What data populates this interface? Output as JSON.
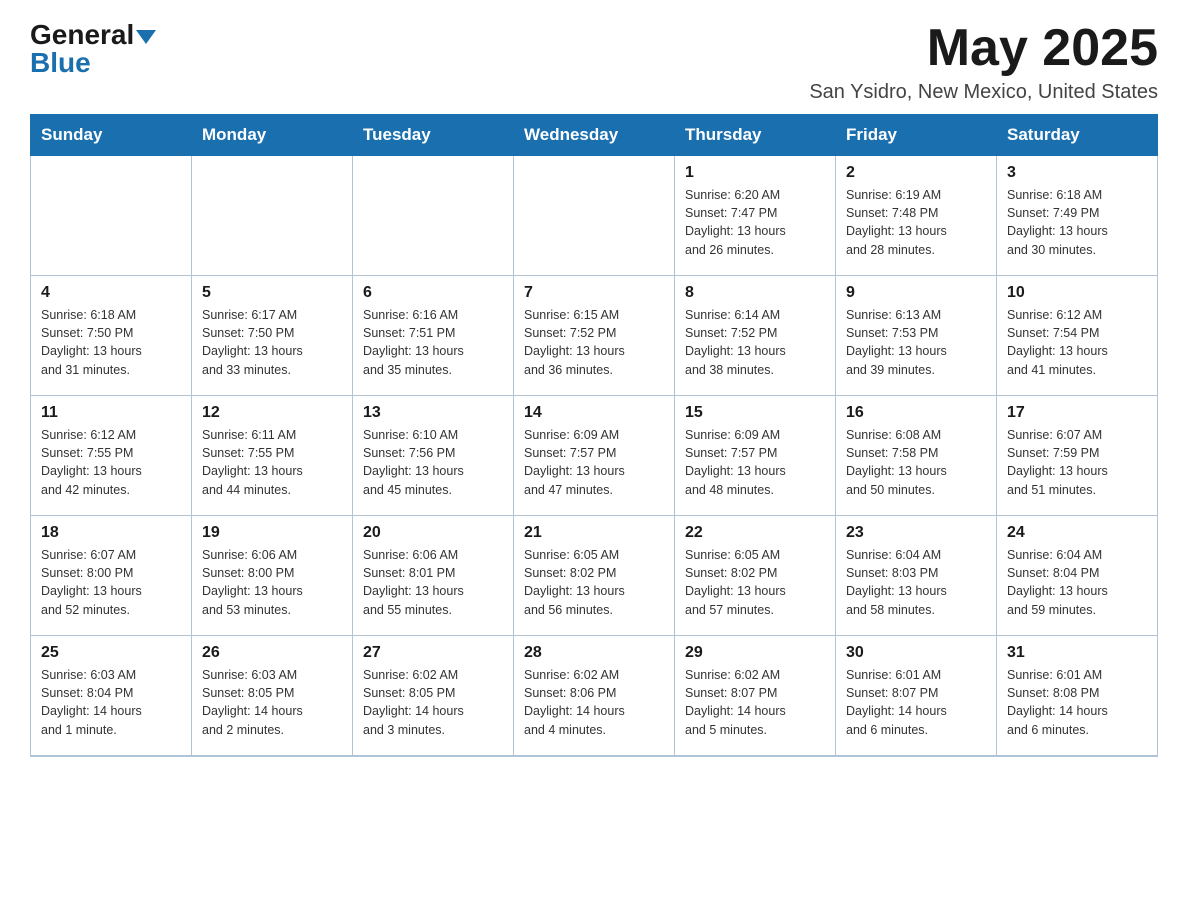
{
  "header": {
    "logo_line1": "General",
    "logo_line2": "Blue",
    "month_year": "May 2025",
    "location": "San Ysidro, New Mexico, United States"
  },
  "days_of_week": [
    "Sunday",
    "Monday",
    "Tuesday",
    "Wednesday",
    "Thursday",
    "Friday",
    "Saturday"
  ],
  "weeks": [
    [
      {
        "day": "",
        "info": ""
      },
      {
        "day": "",
        "info": ""
      },
      {
        "day": "",
        "info": ""
      },
      {
        "day": "",
        "info": ""
      },
      {
        "day": "1",
        "info": "Sunrise: 6:20 AM\nSunset: 7:47 PM\nDaylight: 13 hours\nand 26 minutes."
      },
      {
        "day": "2",
        "info": "Sunrise: 6:19 AM\nSunset: 7:48 PM\nDaylight: 13 hours\nand 28 minutes."
      },
      {
        "day": "3",
        "info": "Sunrise: 6:18 AM\nSunset: 7:49 PM\nDaylight: 13 hours\nand 30 minutes."
      }
    ],
    [
      {
        "day": "4",
        "info": "Sunrise: 6:18 AM\nSunset: 7:50 PM\nDaylight: 13 hours\nand 31 minutes."
      },
      {
        "day": "5",
        "info": "Sunrise: 6:17 AM\nSunset: 7:50 PM\nDaylight: 13 hours\nand 33 minutes."
      },
      {
        "day": "6",
        "info": "Sunrise: 6:16 AM\nSunset: 7:51 PM\nDaylight: 13 hours\nand 35 minutes."
      },
      {
        "day": "7",
        "info": "Sunrise: 6:15 AM\nSunset: 7:52 PM\nDaylight: 13 hours\nand 36 minutes."
      },
      {
        "day": "8",
        "info": "Sunrise: 6:14 AM\nSunset: 7:52 PM\nDaylight: 13 hours\nand 38 minutes."
      },
      {
        "day": "9",
        "info": "Sunrise: 6:13 AM\nSunset: 7:53 PM\nDaylight: 13 hours\nand 39 minutes."
      },
      {
        "day": "10",
        "info": "Sunrise: 6:12 AM\nSunset: 7:54 PM\nDaylight: 13 hours\nand 41 minutes."
      }
    ],
    [
      {
        "day": "11",
        "info": "Sunrise: 6:12 AM\nSunset: 7:55 PM\nDaylight: 13 hours\nand 42 minutes."
      },
      {
        "day": "12",
        "info": "Sunrise: 6:11 AM\nSunset: 7:55 PM\nDaylight: 13 hours\nand 44 minutes."
      },
      {
        "day": "13",
        "info": "Sunrise: 6:10 AM\nSunset: 7:56 PM\nDaylight: 13 hours\nand 45 minutes."
      },
      {
        "day": "14",
        "info": "Sunrise: 6:09 AM\nSunset: 7:57 PM\nDaylight: 13 hours\nand 47 minutes."
      },
      {
        "day": "15",
        "info": "Sunrise: 6:09 AM\nSunset: 7:57 PM\nDaylight: 13 hours\nand 48 minutes."
      },
      {
        "day": "16",
        "info": "Sunrise: 6:08 AM\nSunset: 7:58 PM\nDaylight: 13 hours\nand 50 minutes."
      },
      {
        "day": "17",
        "info": "Sunrise: 6:07 AM\nSunset: 7:59 PM\nDaylight: 13 hours\nand 51 minutes."
      }
    ],
    [
      {
        "day": "18",
        "info": "Sunrise: 6:07 AM\nSunset: 8:00 PM\nDaylight: 13 hours\nand 52 minutes."
      },
      {
        "day": "19",
        "info": "Sunrise: 6:06 AM\nSunset: 8:00 PM\nDaylight: 13 hours\nand 53 minutes."
      },
      {
        "day": "20",
        "info": "Sunrise: 6:06 AM\nSunset: 8:01 PM\nDaylight: 13 hours\nand 55 minutes."
      },
      {
        "day": "21",
        "info": "Sunrise: 6:05 AM\nSunset: 8:02 PM\nDaylight: 13 hours\nand 56 minutes."
      },
      {
        "day": "22",
        "info": "Sunrise: 6:05 AM\nSunset: 8:02 PM\nDaylight: 13 hours\nand 57 minutes."
      },
      {
        "day": "23",
        "info": "Sunrise: 6:04 AM\nSunset: 8:03 PM\nDaylight: 13 hours\nand 58 minutes."
      },
      {
        "day": "24",
        "info": "Sunrise: 6:04 AM\nSunset: 8:04 PM\nDaylight: 13 hours\nand 59 minutes."
      }
    ],
    [
      {
        "day": "25",
        "info": "Sunrise: 6:03 AM\nSunset: 8:04 PM\nDaylight: 14 hours\nand 1 minute."
      },
      {
        "day": "26",
        "info": "Sunrise: 6:03 AM\nSunset: 8:05 PM\nDaylight: 14 hours\nand 2 minutes."
      },
      {
        "day": "27",
        "info": "Sunrise: 6:02 AM\nSunset: 8:05 PM\nDaylight: 14 hours\nand 3 minutes."
      },
      {
        "day": "28",
        "info": "Sunrise: 6:02 AM\nSunset: 8:06 PM\nDaylight: 14 hours\nand 4 minutes."
      },
      {
        "day": "29",
        "info": "Sunrise: 6:02 AM\nSunset: 8:07 PM\nDaylight: 14 hours\nand 5 minutes."
      },
      {
        "day": "30",
        "info": "Sunrise: 6:01 AM\nSunset: 8:07 PM\nDaylight: 14 hours\nand 6 minutes."
      },
      {
        "day": "31",
        "info": "Sunrise: 6:01 AM\nSunset: 8:08 PM\nDaylight: 14 hours\nand 6 minutes."
      }
    ]
  ]
}
